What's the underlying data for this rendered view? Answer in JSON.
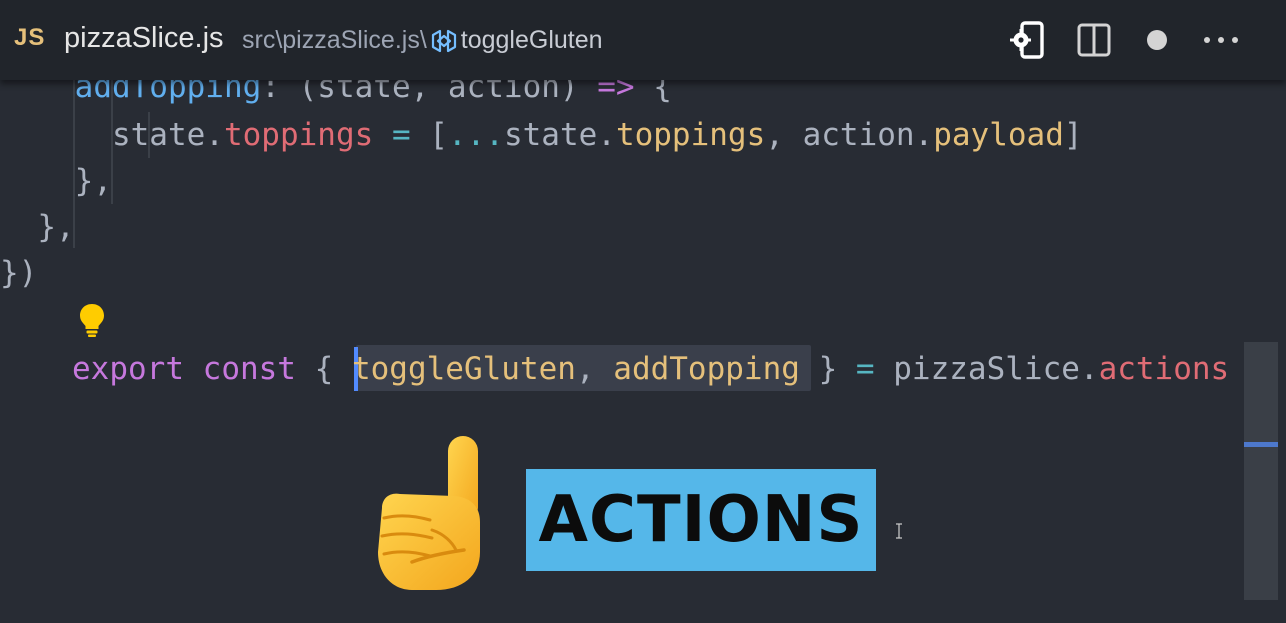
{
  "tab": {
    "language_badge": "JS",
    "file_name": "pizzaSlice.js",
    "breadcrumb_path": "src\\pizzaSlice.js\\",
    "breadcrumb_symbol": "toggleGluten"
  },
  "toolbar": {
    "icons": [
      "device-settings-icon",
      "split-editor-icon",
      "unsaved-dot-icon",
      "more-actions-icon"
    ]
  },
  "code": {
    "line1": {
      "indent": "    ",
      "name": "addTopping",
      "rest": ": (state, action) ",
      "arrow": "=>",
      "brace": " {"
    },
    "line2": {
      "indent": "      ",
      "a": "state.",
      "b": "toppings",
      "c": " ",
      "eq": "=",
      "d": " [",
      "spread": "...",
      "e": "state.",
      "f": "toppings",
      "g": ", action.",
      "h": "payload",
      "i": "]"
    },
    "line3": "    },",
    "line4": "  },",
    "line5": "})",
    "line6": {
      "export": "export",
      "sp1": " ",
      "const": "const",
      "sp2": " { ",
      "sel1": "toggleGluten",
      "sel2": ", ",
      "sel3": "addTopping",
      "sp3": " } ",
      "eq": "=",
      "obj": " pizzaSlice.",
      "prop": "actions"
    }
  },
  "overlay": {
    "banner_text": "ACTIONS"
  },
  "colors": {
    "keyword": "#c678dd",
    "function": "#61afef",
    "property": "#e06c75",
    "field": "#e5c07b",
    "operator": "#56b6c2",
    "banner": "#55b7e9"
  }
}
